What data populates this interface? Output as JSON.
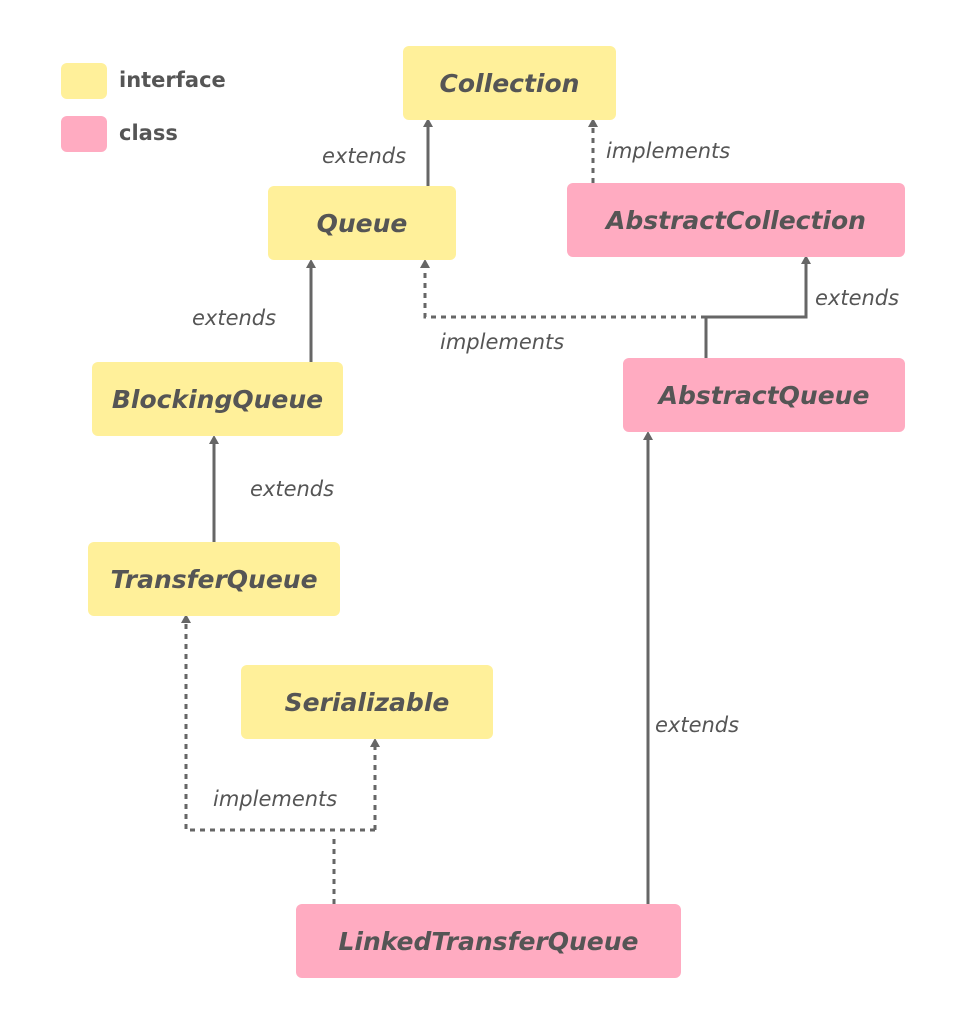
{
  "legend": {
    "interface_label": "interface",
    "class_label": "class",
    "interface_color": "#fff09a",
    "class_color": "#ffabc1"
  },
  "nodes": {
    "collection": "Collection",
    "queue": "Queue",
    "abstract_collection": "AbstractCollection",
    "blocking_queue": "BlockingQueue",
    "abstract_queue": "AbstractQueue",
    "transfer_queue": "TransferQueue",
    "serializable": "Serializable",
    "linked_transfer_queue": "LinkedTransferQueue"
  },
  "edges": {
    "queue_to_collection": "extends",
    "abstractcollection_to_collection": "implements",
    "blockingqueue_to_queue": "extends",
    "abstractqueue_to_abstractcollection": "extends",
    "abstractqueue_to_queue": "implements",
    "transferqueue_to_blockingqueue": "extends",
    "linked_to_abstractqueue": "extends",
    "linked_to_interfaces": "implements"
  },
  "colors": {
    "line": "#666666",
    "text": "#555555"
  }
}
